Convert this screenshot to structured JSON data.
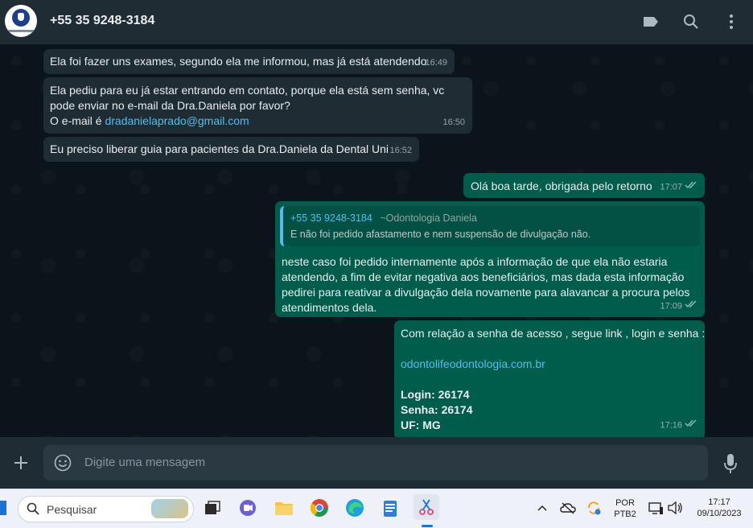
{
  "header": {
    "contact_name": "+55 35 9248-3184",
    "icons": [
      "label-icon",
      "search-icon",
      "menu-dots-icon"
    ]
  },
  "messages": [
    {
      "direction": "incoming",
      "lines": [
        "Ela foi fazer uns exames, segundo ela me informou, mas já está atendendo"
      ],
      "time": "16:49"
    },
    {
      "direction": "incoming",
      "lines": [
        "Ela pediu para eu já estar entrando em contato, porque ela está sem senha,  vc",
        "pode enviar no e-mail da Dra.Daniela por favor?"
      ],
      "email_prefix": "O e-mail é ",
      "email": "dradanielaprado@gmail.com",
      "time": "16:50"
    },
    {
      "direction": "incoming",
      "lines": [
        "Eu preciso liberar guia para pacientes da Dra.Daniela da Dental Uni"
      ],
      "time": "16:52"
    },
    {
      "direction": "outgoing",
      "lines": [
        "Olá boa tarde, obrigada pelo retorno"
      ],
      "time": "17:07"
    },
    {
      "direction": "outgoing",
      "quote": {
        "author": "+55 35 9248-3184",
        "author_alias": "~Odontologia Daniela",
        "text": "E não foi pedido afastamento e nem suspensão de divulgação não."
      },
      "lines": [
        "neste caso foi pedido internamente após a informação de que ela não estaria",
        "atendendo, a fim de evitar negativa aos beneficiários, mas dada esta informação",
        "pedirei para reativar a divulgação dela novamente para alavancar a procura pelos",
        "atendimentos dela."
      ],
      "time": "17:09"
    },
    {
      "direction": "outgoing",
      "lines": [
        "Com relação a senha de acesso , segue link , login e senha :"
      ],
      "link": "odontolifeodontologia.com.br",
      "bold_lines": [
        "Login: 26174",
        "Senha: 26174",
        "UF: MG"
      ],
      "time": "17:16"
    }
  ],
  "composer": {
    "placeholder": "Digite uma mensagem"
  },
  "taskbar": {
    "search_placeholder": "Pesquisar",
    "language": "POR",
    "layout": "PTB2",
    "clock_time": "17:17",
    "clock_date": "09/10/2023"
  },
  "colors": {
    "incoming": "#202c33",
    "outgoing": "#005c4b",
    "link": "#53bdeb",
    "background": "#0b141a"
  }
}
